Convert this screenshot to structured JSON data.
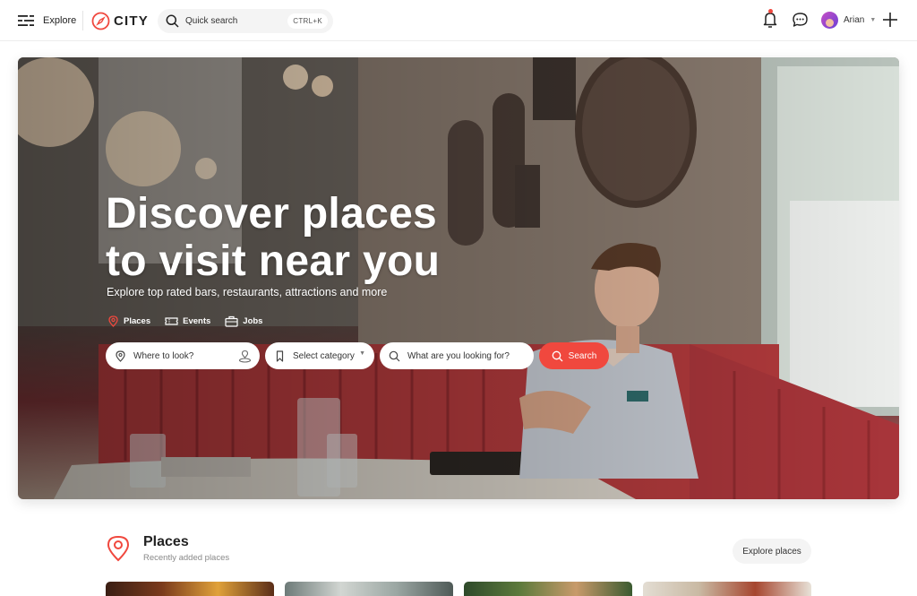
{
  "topbar": {
    "menu_label": "Explore",
    "logo_text": "CITY",
    "quick_search_label": "Quick search",
    "quick_search_shortcut": "CTRL+K",
    "user_name": "Arian"
  },
  "hero": {
    "title_line1": "Discover places",
    "title_line2": "to visit near you",
    "subtitle": "Explore top rated bars, restaurants, attractions and more",
    "tabs": [
      {
        "label": "Places",
        "icon": "map-pin-icon"
      },
      {
        "label": "Events",
        "icon": "ticket-icon"
      },
      {
        "label": "Jobs",
        "icon": "briefcase-icon"
      }
    ],
    "search": {
      "where_placeholder": "Where to look?",
      "category_selected": "Select category",
      "what_placeholder": "What are you looking for?",
      "button_label": "Search"
    }
  },
  "places": {
    "title": "Places",
    "subtitle": "Recently added places",
    "explore_label": "Explore places"
  },
  "colors": {
    "accent": "#f0483e",
    "text": "#222222",
    "muted": "#888888",
    "pill_bg": "#f4f4f4"
  }
}
